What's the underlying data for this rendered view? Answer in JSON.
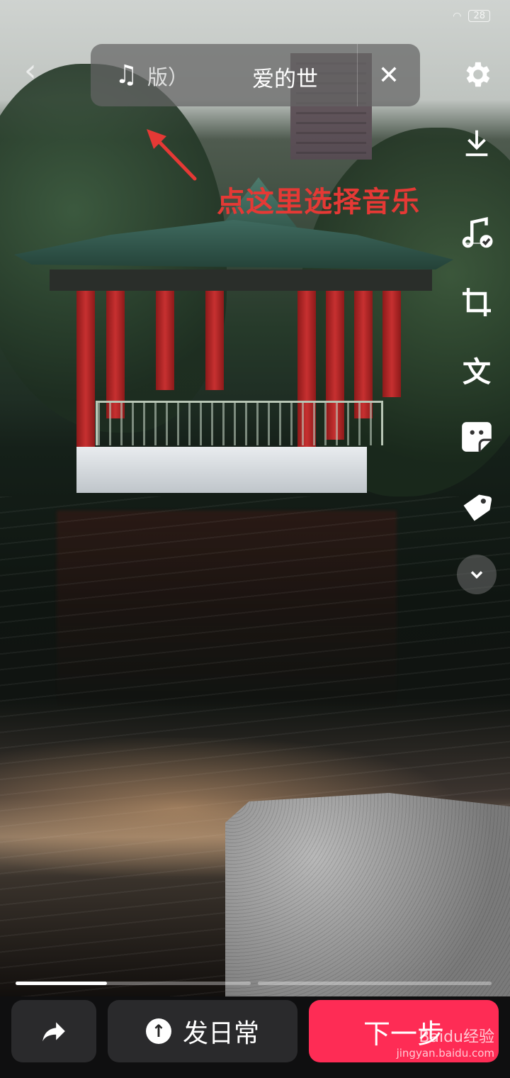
{
  "status_bar": {
    "battery": "28"
  },
  "music": {
    "note_icon": "music-note-icon",
    "song_fragment": "版）",
    "song_title": "爱的世",
    "close_icon": "close-icon"
  },
  "annotation": {
    "text": "点这里选择音乐",
    "color": "#e53935"
  },
  "toolbar": {
    "icons": [
      "gear-icon",
      "download-icon",
      "music-check-icon",
      "crop-icon",
      "text-icon",
      "sticker-icon",
      "tag-icon",
      "chevron-down-icon"
    ],
    "text_glyph": "文"
  },
  "progress": {
    "segment1_fraction": 0.39,
    "segment2_fraction": 0.0
  },
  "bottom_bar": {
    "share_icon": "share-icon",
    "daily_label": "发日常",
    "next_label": "下一步",
    "accent": "#fe2c55"
  },
  "watermark": {
    "brand": "Baidu经验",
    "url": "jingyan.baidu.com"
  }
}
